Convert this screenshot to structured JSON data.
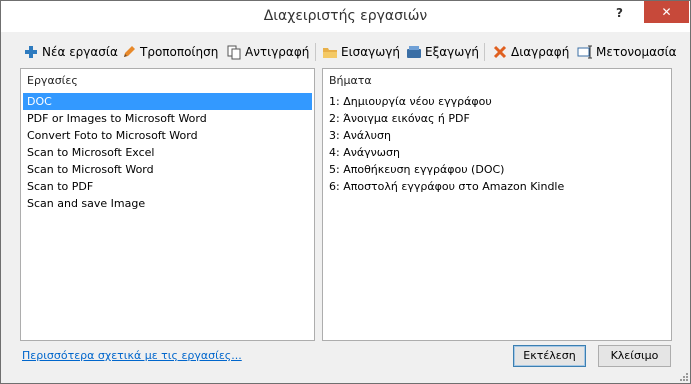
{
  "window": {
    "title": "Διαχειριστής εργασιών",
    "help_label": "?",
    "close_label": "✕"
  },
  "toolbar": {
    "new": "Νέα εργασία",
    "edit": "Τροποποίηση",
    "copy": "Αντιγραφή",
    "import": "Εισαγωγή",
    "export": "Εξαγωγή",
    "delete": "Διαγραφή",
    "rename": "Μετονομασία",
    "icons": {
      "new": "plus-icon",
      "edit": "pencil-icon",
      "copy": "copy-icon",
      "import": "folder-icon",
      "export": "disk-icon",
      "delete": "x-icon",
      "rename": "rename-icon"
    }
  },
  "tasks": {
    "header": "Εργασίες",
    "items": [
      "DOC",
      "PDF or Images to Microsoft Word",
      "Convert Foto to Microsoft Word",
      "Scan to Microsoft Excel",
      "Scan to Microsoft Word",
      "Scan to PDF",
      "Scan and save Image"
    ],
    "selected": "DOC"
  },
  "steps": {
    "header": "Βήματα",
    "items": [
      "1: Δημιουργία νέου εγγράφου",
      "2: Άνοιγμα εικόνας ή PDF",
      "3: Ανάλυση",
      "4: Ανάγνωση",
      "5: Αποθήκευση εγγράφου (DOC)",
      "6: Αποστολή εγγράφου στο Amazon Kindle"
    ]
  },
  "footer": {
    "link": "Περισσότερα σχετικά με τις εργασίες...",
    "run": "Εκτέλεση",
    "close": "Κλείσιμο"
  },
  "colors": {
    "selection": "#3399ff",
    "close_button": "#c7493a",
    "link": "#0066cc"
  }
}
